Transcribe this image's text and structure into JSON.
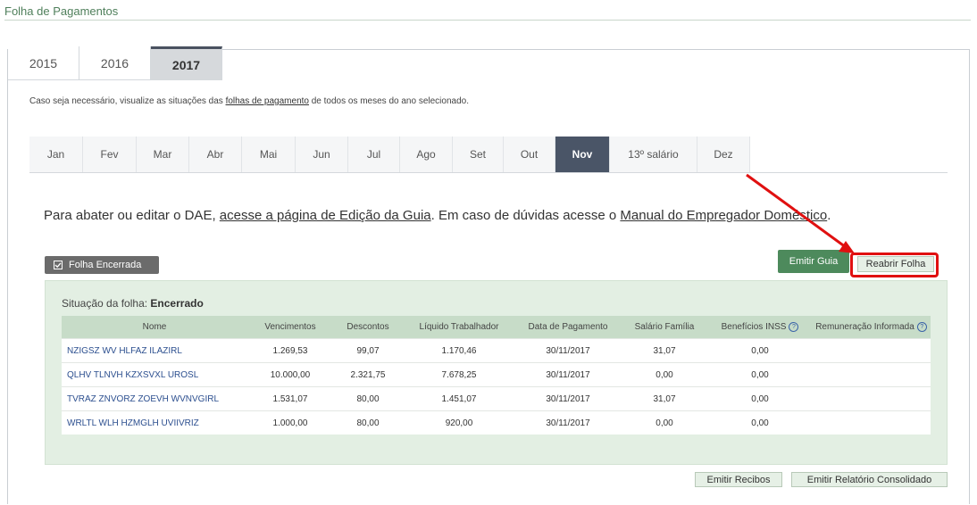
{
  "page": {
    "title": "Folha de Pagamentos"
  },
  "years": [
    {
      "label": "2015",
      "active": false
    },
    {
      "label": "2016",
      "active": false
    },
    {
      "label": "2017",
      "active": true
    }
  ],
  "info": {
    "prefix": "Caso seja necessário, visualize as situações das ",
    "link": "folhas de pagamento",
    "suffix": " de todos os meses do ano selecionado."
  },
  "months": [
    {
      "label": "Jan",
      "active": false
    },
    {
      "label": "Fev",
      "active": false
    },
    {
      "label": "Mar",
      "active": false
    },
    {
      "label": "Abr",
      "active": false
    },
    {
      "label": "Mai",
      "active": false
    },
    {
      "label": "Jun",
      "active": false
    },
    {
      "label": "Jul",
      "active": false
    },
    {
      "label": "Ago",
      "active": false
    },
    {
      "label": "Set",
      "active": false
    },
    {
      "label": "Out",
      "active": false
    },
    {
      "label": "Nov",
      "active": true
    },
    {
      "label": "13º salário",
      "active": false
    },
    {
      "label": "Dez",
      "active": false
    }
  ],
  "dae": {
    "prefix": "Para abater ou editar o DAE, ",
    "link1": "acesse a página de Edição da Guia",
    "middle": ". Em caso de dúvidas acesse o ",
    "link2": "Manual do Empregador Doméstico",
    "suffix": "."
  },
  "status_badge": {
    "label": "Folha Encerrada",
    "icon": "checkbox-icon"
  },
  "actions": {
    "emitir_guia": "Emitir Guia",
    "reabrir_folha": "Reabrir Folha",
    "emitir_recibos": "Emitir Recibos",
    "emitir_relatorio": "Emitir Relatório Consolidado"
  },
  "situation": {
    "label": "Situação da folha:",
    "value": "Encerrado"
  },
  "table": {
    "headers": {
      "nome": "Nome",
      "vencimentos": "Vencimentos",
      "descontos": "Descontos",
      "liquido": "Líquido Trabalhador",
      "data": "Data de Pagamento",
      "salario_familia": "Salário Família",
      "beneficios": "Benefícios INSS",
      "remuneracao": "Remuneração Informada"
    },
    "help_icon": "?",
    "rows": [
      {
        "nome": "NZIGSZ WV HLFAZ ILAZIRL",
        "vencimentos": "1.269,53",
        "descontos": "99,07",
        "liquido": "1.170,46",
        "data": "30/11/2017",
        "salario_familia": "31,07",
        "beneficios": "0,00",
        "remuneracao": ""
      },
      {
        "nome": "QLHV TLNVH KZXSVXL UROSL",
        "vencimentos": "10.000,00",
        "descontos": "2.321,75",
        "liquido": "7.678,25",
        "data": "30/11/2017",
        "salario_familia": "0,00",
        "beneficios": "0,00",
        "remuneracao": ""
      },
      {
        "nome": "TVRAZ ZNVORZ ZOEVH WVNVGIRL",
        "vencimentos": "1.531,07",
        "descontos": "80,00",
        "liquido": "1.451,07",
        "data": "30/11/2017",
        "salario_familia": "31,07",
        "beneficios": "0,00",
        "remuneracao": ""
      },
      {
        "nome": "WRLTL WLH HZMGLH UVIIVRIZ",
        "vencimentos": "1.000,00",
        "descontos": "80,00",
        "liquido": "920,00",
        "data": "30/11/2017",
        "salario_familia": "0,00",
        "beneficios": "0,00",
        "remuneracao": ""
      }
    ]
  },
  "colors": {
    "accent_green": "#4d8a5c",
    "highlight_red": "#e01010",
    "active_tab": "#4a5567"
  }
}
